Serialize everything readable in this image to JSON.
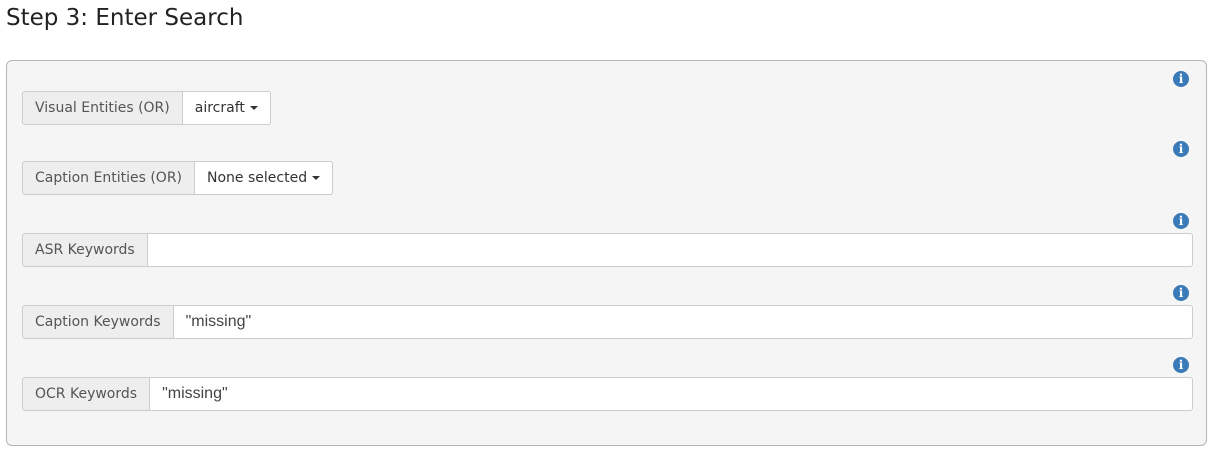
{
  "page": {
    "title": "Step 3: Enter Search"
  },
  "form": {
    "info_glyph": "i",
    "visual_entities": {
      "label": "Visual Entities (OR)",
      "selected": "aircraft"
    },
    "caption_entities": {
      "label": "Caption Entities (OR)",
      "selected": "None selected"
    },
    "asr_keywords": {
      "label": "ASR Keywords",
      "value": ""
    },
    "caption_keywords": {
      "label": "Caption Keywords",
      "value": "\"missing\""
    },
    "ocr_keywords": {
      "label": "OCR Keywords",
      "value": "\"missing\""
    }
  },
  "icons": {
    "info": "info-circle-icon",
    "caret": "caret-down-icon"
  },
  "colors": {
    "info_icon": "#3a7ab8",
    "panel_bg": "#f5f5f5",
    "addon_bg": "#eeeeee"
  }
}
